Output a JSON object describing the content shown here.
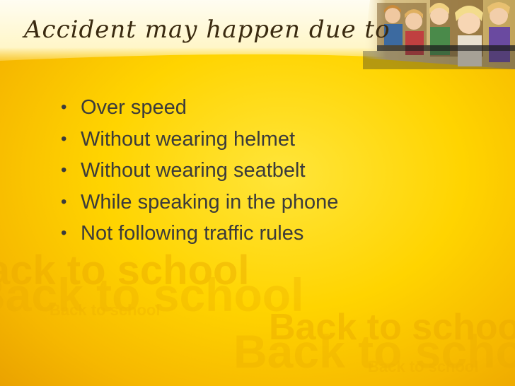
{
  "slide": {
    "title": "Accident may happen due to",
    "bullets": [
      "Over speed",
      "Without wearing helmet",
      "Without wearing seatbelt",
      "While speaking in the phone",
      "Not following traffic rules"
    ],
    "watermark_text": "Back to school",
    "colors": {
      "background": "#ffd400",
      "text": "#3b3b3b",
      "title": "#3a2a10"
    }
  }
}
